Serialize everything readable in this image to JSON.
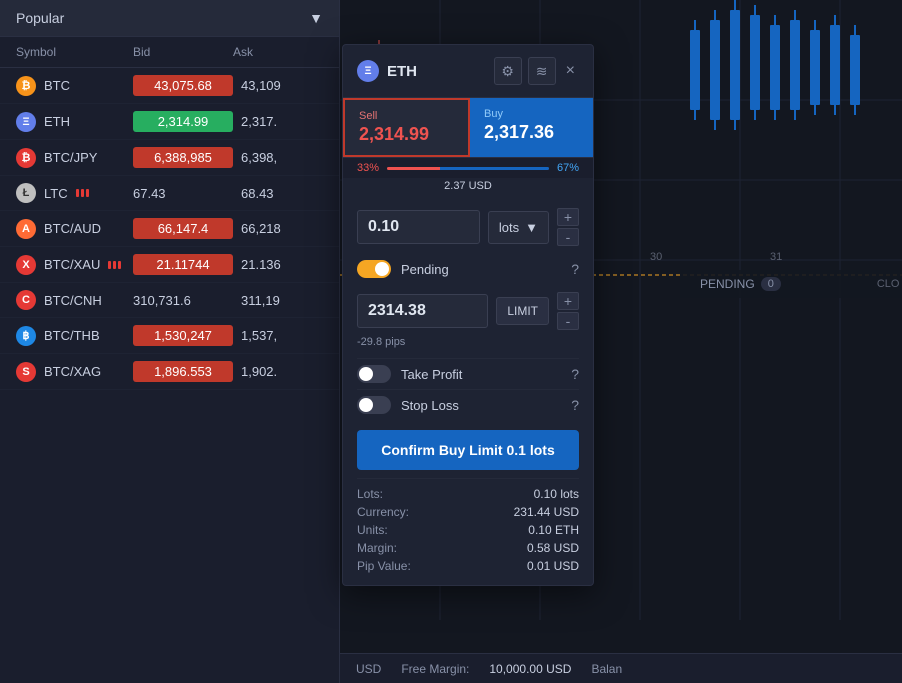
{
  "dropdown": {
    "label": "Popular",
    "arrow": "▼"
  },
  "table": {
    "headers": [
      "Symbol",
      "Bid",
      "Ask"
    ],
    "rows": [
      {
        "id": "btc",
        "name": "BTC",
        "icon": "B",
        "iconClass": "icon-btc",
        "bid": "43,075.68",
        "bidClass": "bid-orange",
        "ask": "43,109",
        "askTrunc": true
      },
      {
        "id": "eth",
        "name": "ETH",
        "icon": "E",
        "iconClass": "icon-eth",
        "bid": "2,314.99",
        "bidClass": "bid-green",
        "ask": "2,317.",
        "askTrunc": true
      },
      {
        "id": "btcjpy",
        "name": "BTC/JPY",
        "icon": "₿",
        "iconClass": "icon-btcjpy",
        "bid": "6,388,985",
        "bidClass": "bid-orange",
        "ask": "6,398,",
        "askTrunc": true
      },
      {
        "id": "ltc",
        "name": "LTC",
        "icon": "L",
        "iconClass": "icon-ltc",
        "bid": "67.43",
        "bidClass": "",
        "ask": "68.43",
        "hasBars": true
      },
      {
        "id": "btcaud",
        "name": "BTC/AUD",
        "icon": "A",
        "iconClass": "icon-btcaud",
        "bid": "66,147.4",
        "bidClass": "bid-orange",
        "ask": "66,218",
        "askTrunc": true
      },
      {
        "id": "btcxau",
        "name": "BTC/XAU",
        "icon": "X",
        "iconClass": "icon-btcxau",
        "bid": "21.11744",
        "bidClass": "bid-orange",
        "ask": "21.136",
        "askTrunc": true,
        "hasBars": true
      },
      {
        "id": "btccnh",
        "name": "BTC/CNH",
        "icon": "C",
        "iconClass": "icon-btccnh",
        "bid": "310,731.6",
        "bidClass": "",
        "ask": "311,19",
        "askTrunc": true
      },
      {
        "id": "btcthb",
        "name": "BTC/THB",
        "icon": "T",
        "iconClass": "icon-btcthb",
        "bid": "1,530,247",
        "bidClass": "bid-orange",
        "ask": "1,537,",
        "askTrunc": true
      },
      {
        "id": "btcxag",
        "name": "BTC/XAG",
        "icon": "S",
        "iconClass": "icon-btcxag",
        "bid": "1,896.553",
        "bidClass": "bid-orange",
        "ask": "1,902.",
        "askTrunc": true
      }
    ]
  },
  "chart": {
    "axis_30": "30",
    "axis_31": "31",
    "pending_label": "PENDING",
    "pending_count": "0",
    "clo_label": "CLO"
  },
  "bottom_bar": {
    "free_margin_label": "Free Margin:",
    "free_margin_value": "10,000.00 USD",
    "balance_label": "Balan"
  },
  "modal": {
    "symbol": "ETH",
    "close_label": "×",
    "sell_label": "Sell",
    "sell_price": "2,314.99",
    "buy_label": "Buy",
    "buy_price": "2,317.36",
    "spread_usd": "2.37 USD",
    "spread_left_pct": "33%",
    "spread_right_pct": "67%",
    "lots_value": "0.10",
    "lots_unit": "lots",
    "lots_dropdown_arrow": "▼",
    "plus": "+",
    "minus": "-",
    "pending_label": "Pending",
    "pending_help": "?",
    "limit_value": "2314.38",
    "limit_badge": "LIMIT",
    "pips_info": "-29.8 pips",
    "take_profit_label": "Take Profit",
    "take_profit_help": "?",
    "stop_loss_label": "Stop Loss",
    "stop_loss_help": "?",
    "confirm_btn": "Confirm Buy Limit 0.1 lots",
    "summary": {
      "lots_label": "Lots:",
      "lots_value": "0.10 lots",
      "currency_label": "Currency:",
      "currency_value": "231.44 USD",
      "units_label": "Units:",
      "units_value": "0.10 ETH",
      "margin_label": "Margin:",
      "margin_value": "0.58 USD",
      "pip_label": "Pip Value:",
      "pip_value": "0.01 USD"
    }
  }
}
